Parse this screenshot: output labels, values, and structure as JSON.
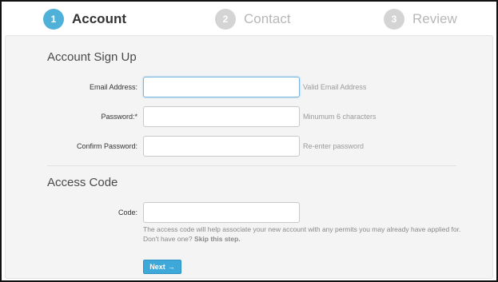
{
  "stepper": {
    "steps": [
      {
        "number": "1",
        "label": "Account",
        "state": "active"
      },
      {
        "number": "2",
        "label": "Contact",
        "state": "inactive"
      },
      {
        "number": "3",
        "label": "Review",
        "state": "inactive"
      }
    ]
  },
  "account_section": {
    "title": "Account Sign Up",
    "fields": [
      {
        "label": "Email Address:",
        "value": "",
        "hint": "Valid Email Address"
      },
      {
        "label": "Password:*",
        "value": "",
        "hint": "Minumum 6 characters"
      },
      {
        "label": "Confirm Password:",
        "value": "",
        "hint": "Re-enter password"
      }
    ]
  },
  "access_section": {
    "title": "Access Code",
    "code_label": "Code:",
    "code_value": "",
    "help_text": "The access code will help associate your new account with any permits you may already have applied for. Don't have one?",
    "skip_link": "Skip this step."
  },
  "actions": {
    "next_label": "Next",
    "next_icon": "arrow-right-icon",
    "next_arrow": "→"
  },
  "colors": {
    "accent": "#4fb0d8",
    "inactive_step": "#d4d4d4",
    "panel_bg": "#f4f4f4",
    "button_bg": "#3ea8d8"
  }
}
